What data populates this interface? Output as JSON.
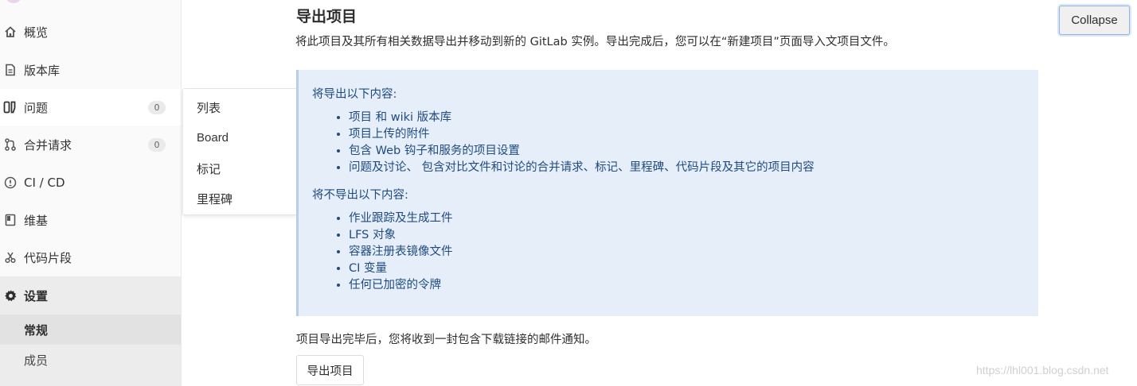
{
  "sidebar": {
    "items": [
      {
        "label": "概览",
        "icon": "home-icon"
      },
      {
        "label": "版本库",
        "icon": "document-icon"
      },
      {
        "label": "问题",
        "icon": "issues-icon",
        "badge": "0"
      },
      {
        "label": "合并请求",
        "icon": "merge-request-icon",
        "badge": "0"
      },
      {
        "label": "CI / CD",
        "icon": "rocket-icon"
      },
      {
        "label": "维基",
        "icon": "book-icon"
      },
      {
        "label": "代码片段",
        "icon": "scissors-icon"
      },
      {
        "label": "设置",
        "icon": "gear-icon"
      }
    ],
    "settings_subitems": [
      {
        "label": "常规",
        "selected": true
      },
      {
        "label": "成员",
        "selected": false
      }
    ]
  },
  "issues_flyout": {
    "items": [
      "列表",
      "Board",
      "标记",
      "里程碑"
    ]
  },
  "main": {
    "title": "导出项目",
    "description": "将此项目及其所有相关数据导出并移动到新的 GitLab 实例。导出完成后，您可以在“新建项目”页面导入文项目文件。",
    "collapse_label": "Collapse",
    "info": {
      "exported_heading": "将导出以下内容:",
      "exported_items": [
        "项目 和 wiki 版本库",
        "项目上传的附件",
        "包含 Web 钩子和服务的项目设置",
        "问题及讨论、 包含对比文件和讨论的合并请求、标记、里程碑、代码片段及其它的项目内容"
      ],
      "not_exported_heading": "将不导出以下内容:",
      "not_exported_items": [
        "作业跟踪及生成工件",
        "LFS 对象",
        "容器注册表镜像文件",
        "CI 变量",
        "任何已加密的令牌"
      ]
    },
    "footer_note": "项目导出完毕后，您将收到一封包含下载链接的邮件通知。",
    "export_button": "导出项目"
  },
  "watermark": "https://lhl001.blog.csdn.net",
  "colors": {
    "info_background": "#e5eef9",
    "info_text": "#1f4b80",
    "sidebar_background": "#fafafa"
  }
}
